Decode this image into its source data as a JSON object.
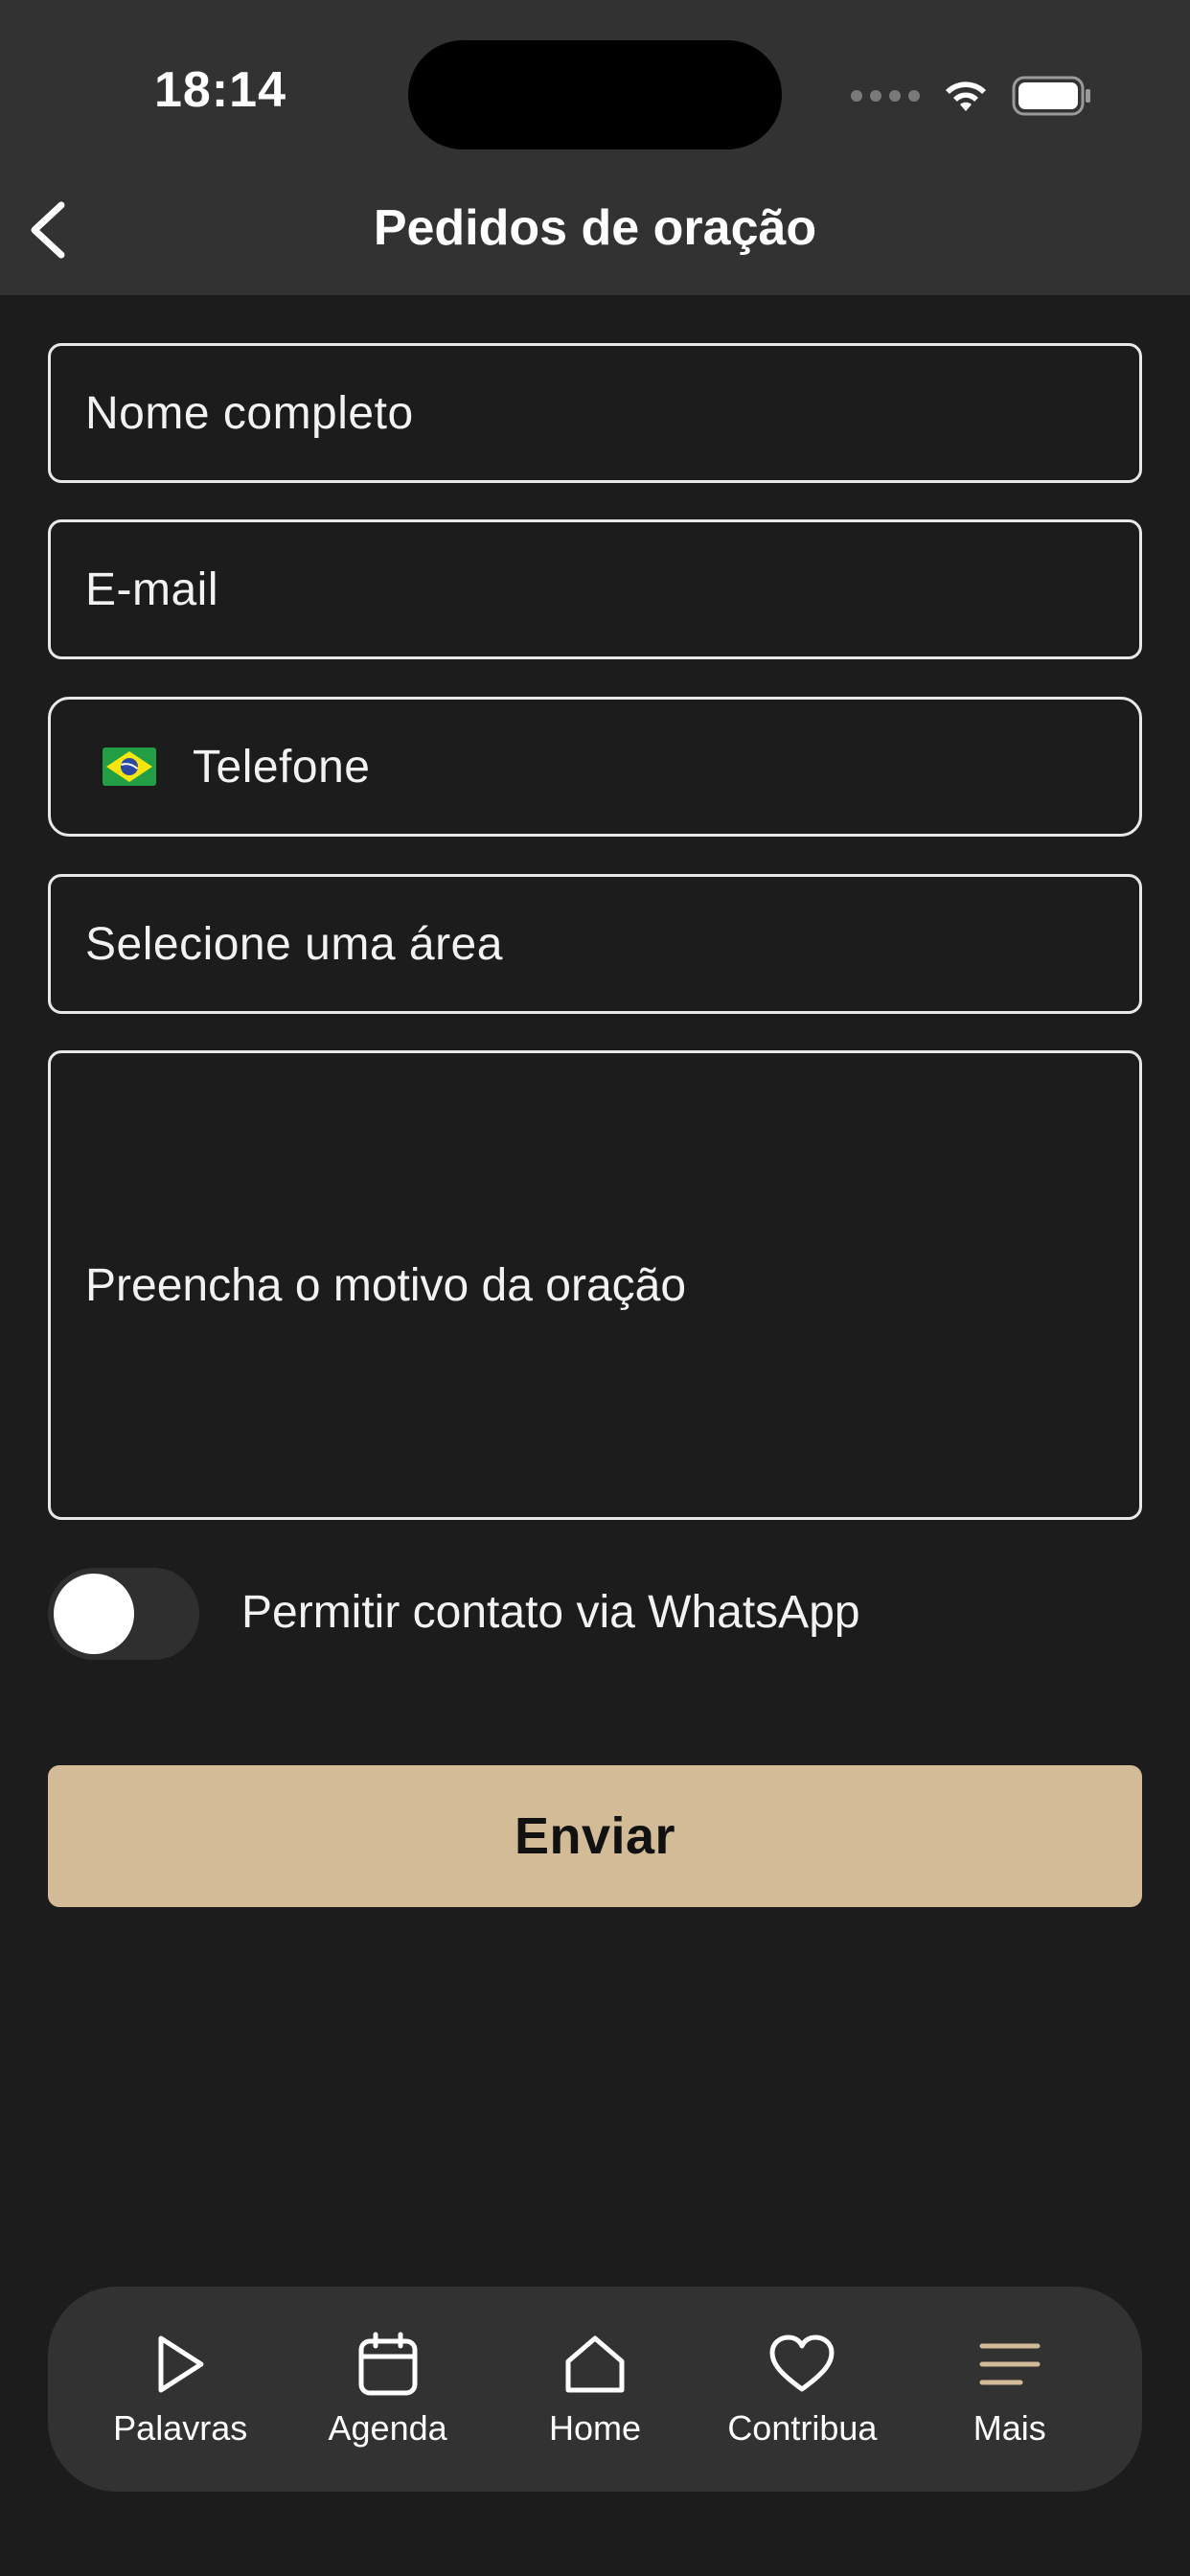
{
  "status_bar": {
    "time": "18:14"
  },
  "header": {
    "title": "Pedidos de oração",
    "back_icon": "chevron-left-icon"
  },
  "form": {
    "name_placeholder": "Nome completo",
    "email_placeholder": "E-mail",
    "phone_placeholder": "Telefone",
    "phone_flag_icon": "brazil-flag-icon",
    "area_placeholder": "Selecione uma área",
    "reason_placeholder": "Preencha o motivo da oração",
    "whatsapp_toggle_label": "Permitir contato via WhatsApp",
    "whatsapp_toggle_on": false,
    "submit_label": "Enviar"
  },
  "tabbar": {
    "items": [
      {
        "label": "Palavras",
        "icon": "play-icon"
      },
      {
        "label": "Agenda",
        "icon": "calendar-icon"
      },
      {
        "label": "Home",
        "icon": "home-icon"
      },
      {
        "label": "Contribua",
        "icon": "heart-icon"
      },
      {
        "label": "Mais",
        "icon": "menu-icon"
      }
    ]
  },
  "colors": {
    "background": "#1c1c1c",
    "header": "#323232",
    "accent": "#d3bb98"
  }
}
